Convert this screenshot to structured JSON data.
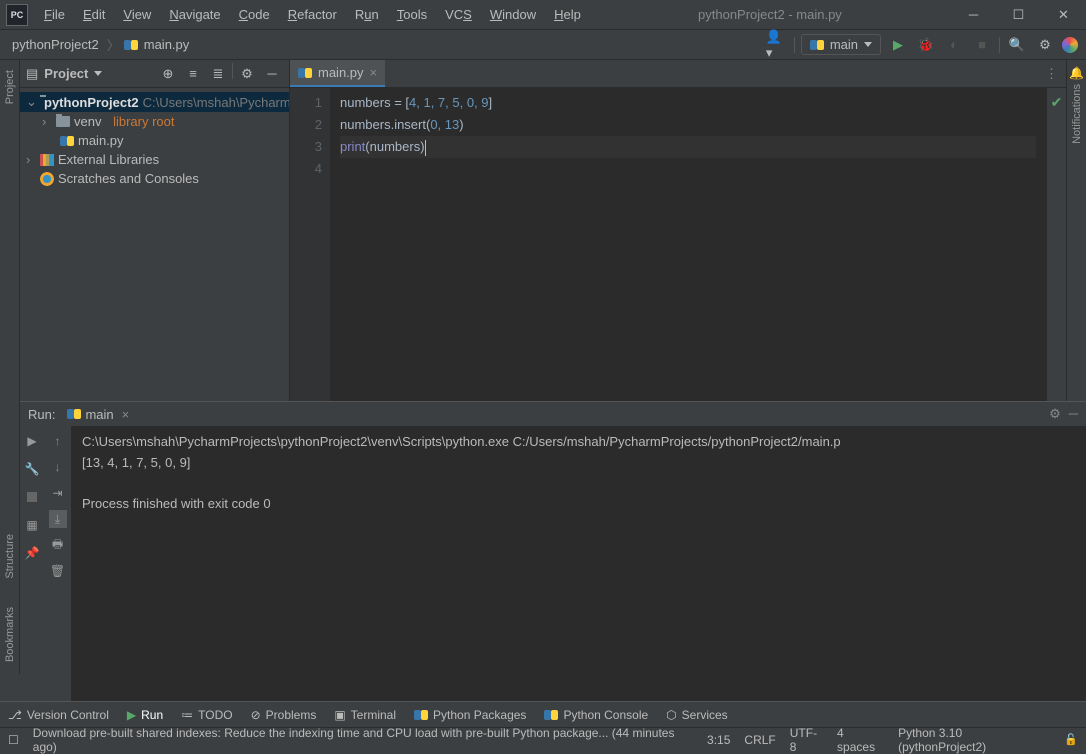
{
  "window": {
    "title": "pythonProject2 - main.py",
    "menus": [
      "File",
      "Edit",
      "View",
      "Navigate",
      "Code",
      "Refactor",
      "Run",
      "Tools",
      "VCS",
      "Window",
      "Help"
    ]
  },
  "breadcrumb": {
    "project": "pythonProject2",
    "file": "main.py"
  },
  "run_config": {
    "name": "main"
  },
  "project_pane": {
    "title": "Project",
    "root_name": "pythonProject2",
    "root_path": "C:\\Users\\mshah\\Pycharm",
    "venv": "venv",
    "venv_tag": "library root",
    "mainfile": "main.py",
    "external": "External Libraries",
    "scratches": "Scratches and Consoles"
  },
  "tab": {
    "name": "main.py"
  },
  "editor": {
    "lines": [
      "1",
      "2",
      "3",
      "4"
    ],
    "code1_a": "numbers = [",
    "code1_nums": "4, 1, 7, 5, 0, 9",
    "code1_b": "]",
    "code2_a": "numbers.insert(",
    "code2_nums": "0, 13",
    "code2_b": ")",
    "code3_print": "print",
    "code3_open": "(",
    "code3_var": "numbers",
    "code3_close": ")"
  },
  "run": {
    "label": "Run:",
    "tab": "main",
    "out_cmd": "C:\\Users\\mshah\\PycharmProjects\\pythonProject2\\venv\\Scripts\\python.exe C:/Users/mshah/PycharmProjects/pythonProject2/main.p",
    "out_result": "[13, 4, 1, 7, 5, 0, 9]",
    "out_exit": "Process finished with exit code 0"
  },
  "bottom": {
    "vc": "Version Control",
    "run": "Run",
    "todo": "TODO",
    "problems": "Problems",
    "terminal": "Terminal",
    "pkg": "Python Packages",
    "console": "Python Console",
    "services": "Services"
  },
  "status": {
    "msg": "Download pre-built shared indexes: Reduce the indexing time and CPU load with pre-built Python package... (44 minutes ago)",
    "pos": "3:15",
    "crlf": "CRLF",
    "enc": "UTF-8",
    "indent": "4 spaces",
    "interp": "Python 3.10 (pythonProject2)"
  },
  "side": {
    "project": "Project",
    "structure": "Structure",
    "bookmarks": "Bookmarks",
    "notifications": "Notifications"
  }
}
